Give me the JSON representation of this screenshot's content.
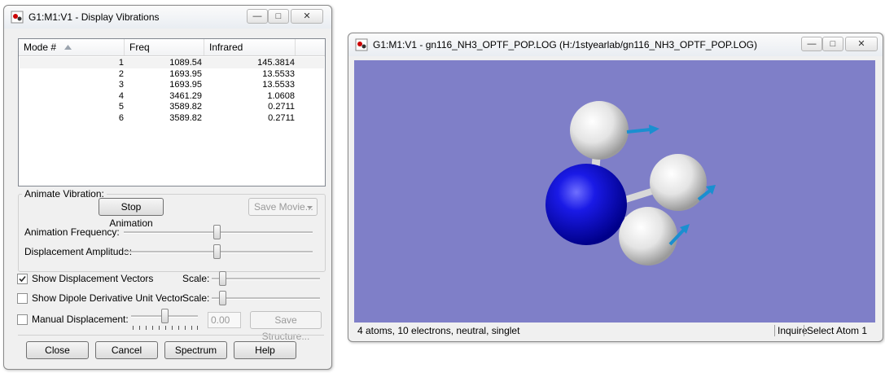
{
  "vib_window": {
    "title": "G1:M1:V1 - Display Vibrations",
    "titlebar_buttons": {
      "minimize": "—",
      "maximize": "□",
      "close": "✕"
    },
    "table": {
      "columns": [
        "Mode #",
        "Freq",
        "Infrared"
      ],
      "rows": [
        {
          "mode": "1",
          "freq": "1089.54",
          "ir": "145.3814"
        },
        {
          "mode": "2",
          "freq": "1693.95",
          "ir": "13.5533"
        },
        {
          "mode": "3",
          "freq": "1693.95",
          "ir": "13.5533"
        },
        {
          "mode": "4",
          "freq": "3461.29",
          "ir": "1.0608"
        },
        {
          "mode": "5",
          "freq": "3589.82",
          "ir": "0.2711"
        },
        {
          "mode": "6",
          "freq": "3589.82",
          "ir": "0.2711"
        }
      ]
    },
    "animate": {
      "group_label": "Animate Vibration:",
      "stop_button": "Stop Animation",
      "save_movie_button": "Save Movie...",
      "frequency_label": "Animation Frequency:",
      "frequency_level": 0.5,
      "amplitude_label": "Displacement Amplitude:",
      "amplitude_level": 0.5
    },
    "options": {
      "show_displacement": {
        "label": "Show Displacement Vectors",
        "checked": true,
        "scale_label": "Scale:"
      },
      "show_dipole": {
        "label": "Show Dipole Derivative Unit Vector",
        "checked": false,
        "scale_label": "Scale:"
      },
      "manual_displacement": {
        "label": "Manual Displacement:",
        "checked": false,
        "value": "0.00",
        "save_structure_button": "Save Structure..."
      }
    },
    "buttons": {
      "close": "Close",
      "cancel": "Cancel",
      "spectrum": "Spectrum",
      "help": "Help"
    }
  },
  "mol_window": {
    "title": "G1:M1:V1 - gn116_NH3_OPTF_POP.LOG (H:/1styearlab/gn116_NH3_OPTF_POP.LOG)",
    "titlebar_buttons": {
      "minimize": "—",
      "maximize": "□",
      "close": "✕"
    },
    "status": {
      "info": "4 atoms, 10 electrons, neutral, singlet",
      "mode": "Inquire",
      "action": "Select Atom 1"
    },
    "colors": {
      "background": "#7f7fc8",
      "nitrogen": "#0a0ad0",
      "hydrogen": "#e8e8e8",
      "vector": "#1a8fd0"
    }
  }
}
